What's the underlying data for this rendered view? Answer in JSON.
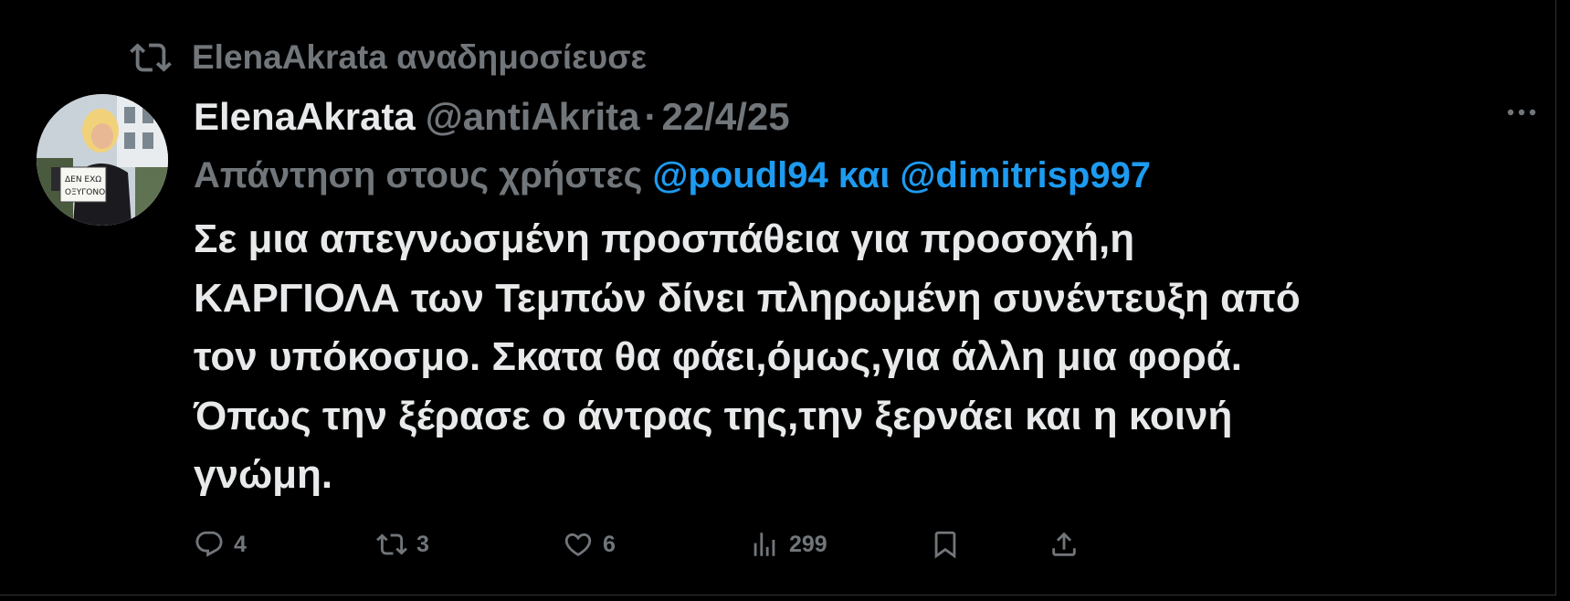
{
  "repost": {
    "label": "ElenaAkrata αναδημοσίευσε"
  },
  "author": {
    "display_name": "ElenaAkrata",
    "handle": "@antiAkrita",
    "separator": "·",
    "date": "22/4/25",
    "avatar_sign_text_1": "ΔΕΝ ΕΧΩ",
    "avatar_sign_text_2": "ΟΞΥΓΟΝΟ"
  },
  "reply": {
    "prefix": "Απάντηση στους χρήστες",
    "mention_1": "@poudl94",
    "conjunction": "και",
    "mention_2": "@dimitrisp997"
  },
  "tweet": {
    "lines": [
      "Σε μια απεγνωσμένη προσπάθεια για προσοχή,η",
      "ΚΑΡΓΙΟΛΑ των Τεμπών δίνει πληρωμένη συνέντευξη από",
      "τον υπόκοσμο. Σκατα θα φάει,όμως,για άλλη μια φορά.",
      "Όπως την ξέρασε ο άντρας της,την ξερνάει και η κοινή",
      "γνώμη."
    ]
  },
  "actions": {
    "replies": "4",
    "reposts": "3",
    "likes": "6",
    "views": "299"
  },
  "icons": {
    "repost_header": "repost-icon",
    "more": "more-icon",
    "reply": "reply-icon",
    "repost": "repost-icon",
    "like": "heart-icon",
    "views": "views-icon",
    "bookmark": "bookmark-icon",
    "share": "share-icon"
  },
  "colors": {
    "background": "#000000",
    "text": "#e7e9ea",
    "muted": "#71767b",
    "link": "#1d9bf0",
    "border": "#2f3336"
  }
}
